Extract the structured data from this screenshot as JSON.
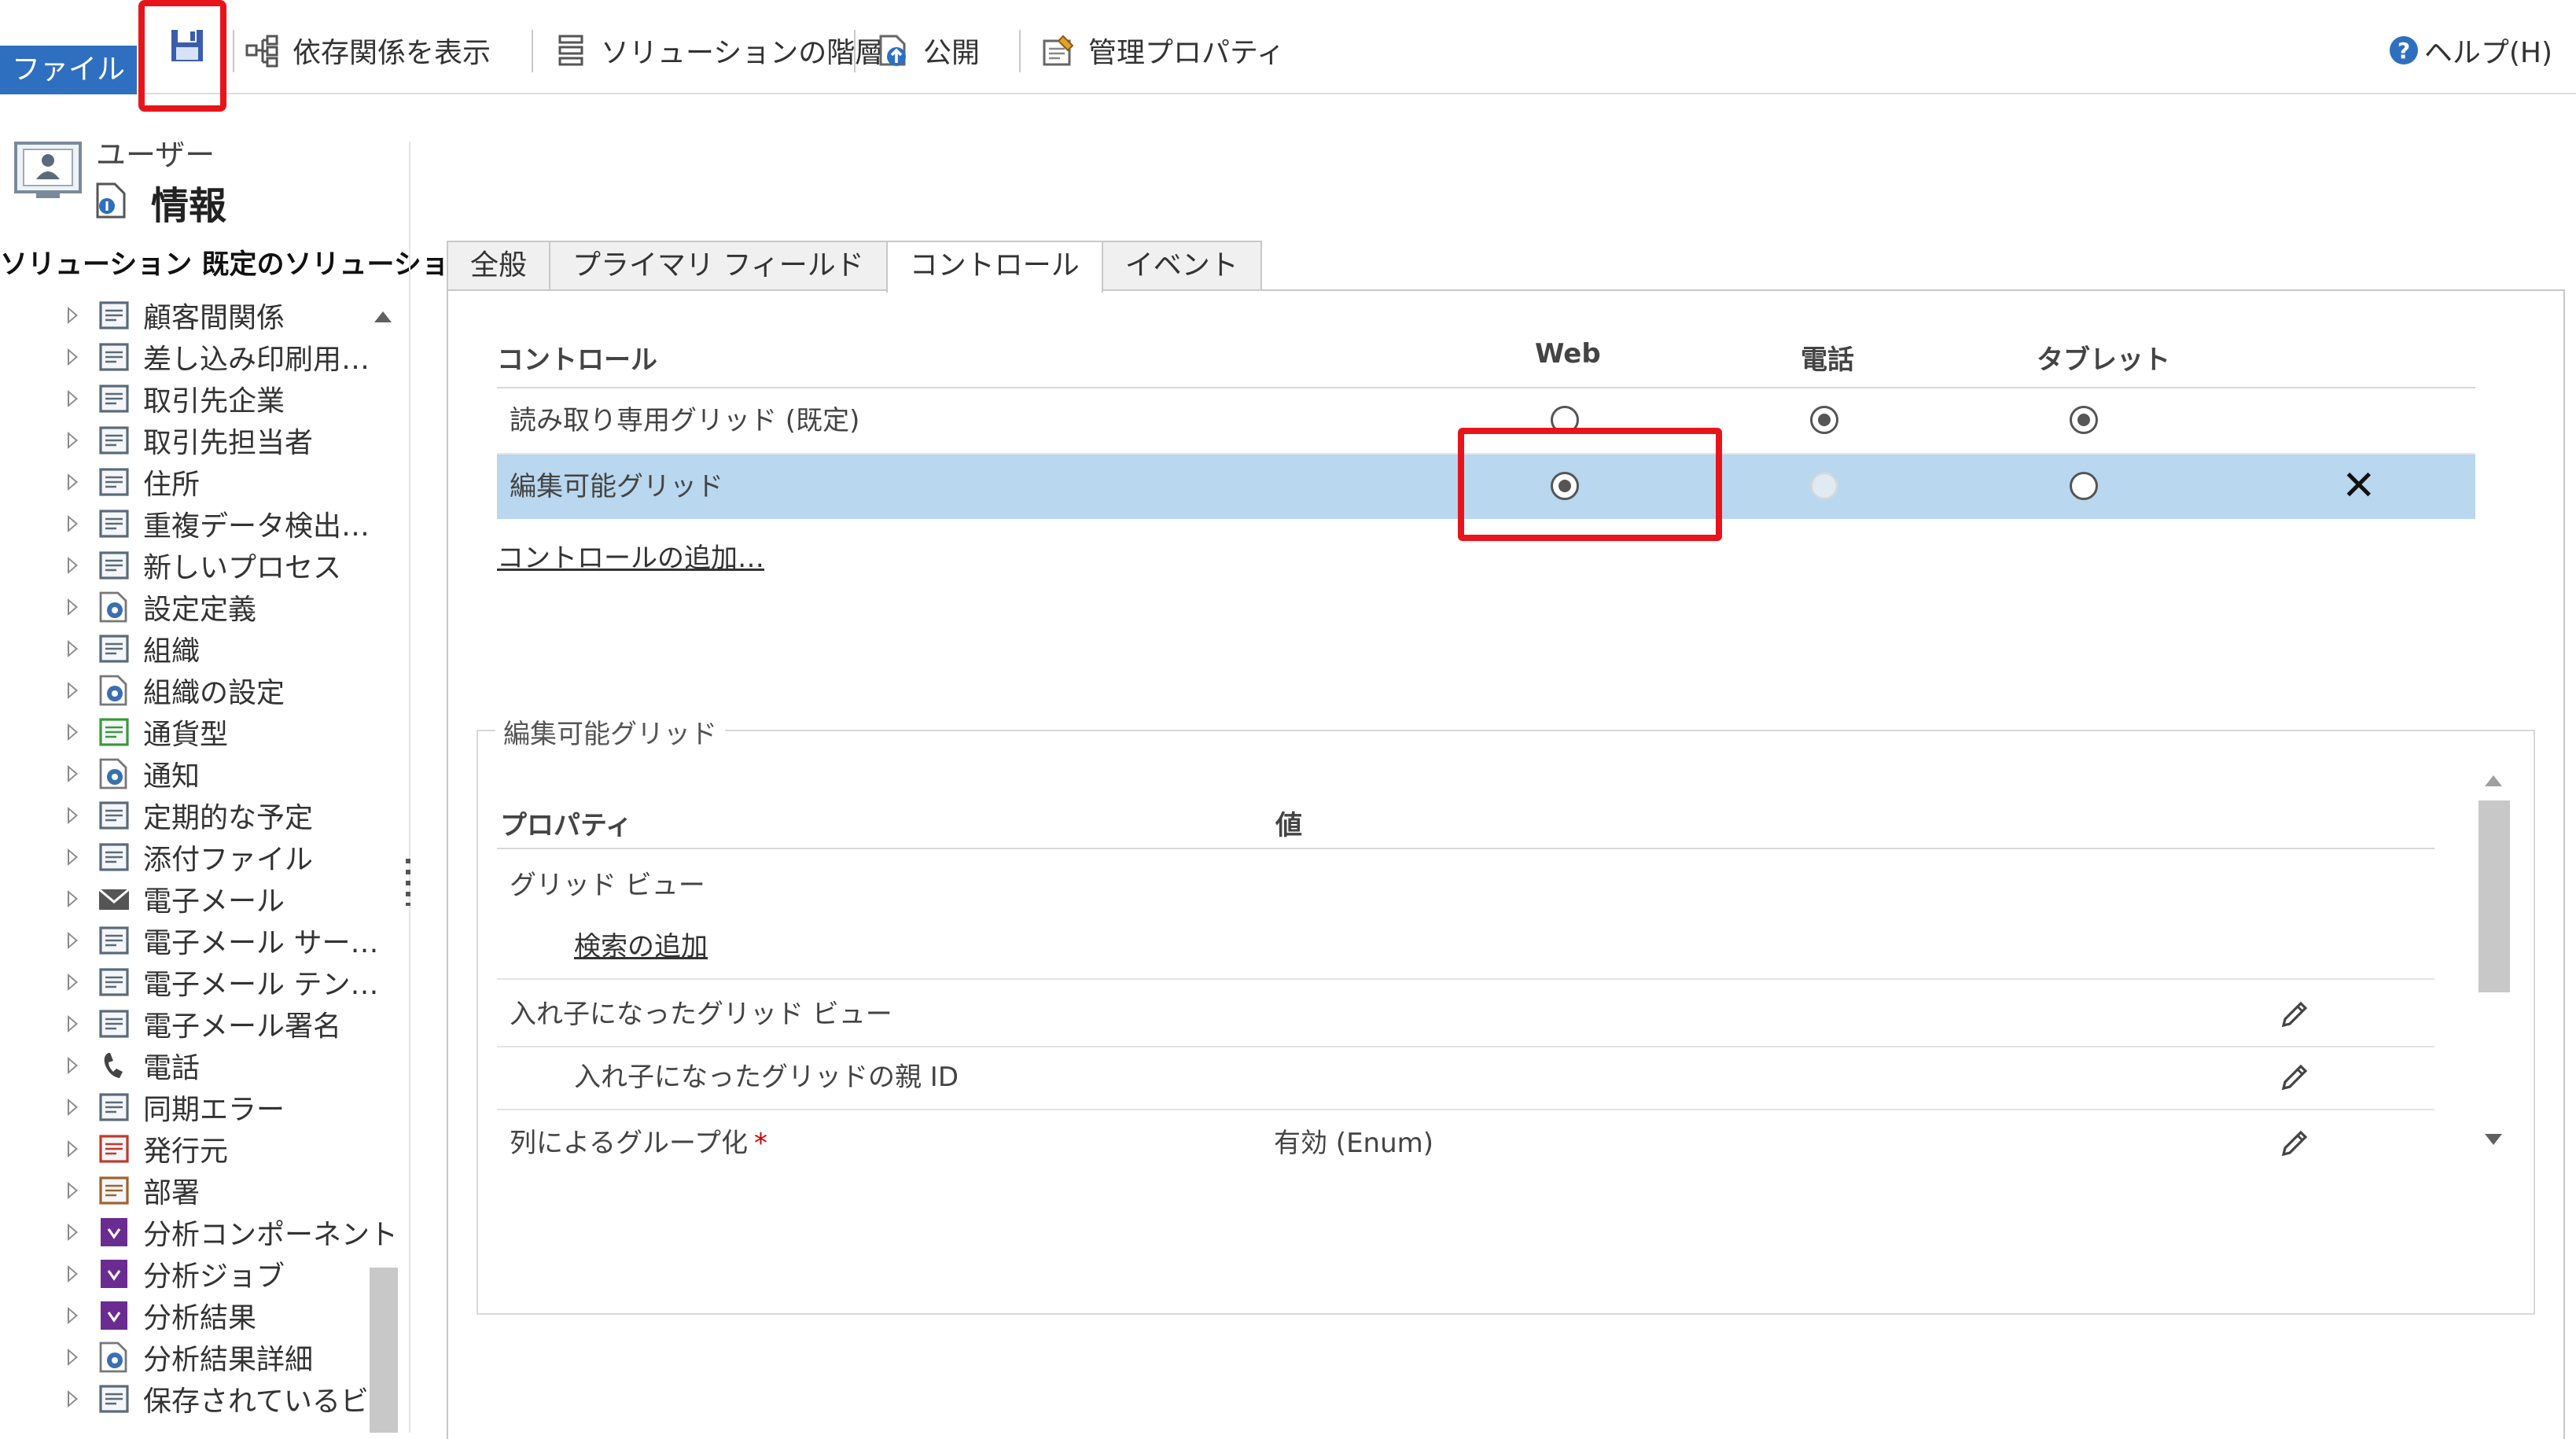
{
  "ribbon": {
    "file_label": "ファイル",
    "save_tooltip": "保存",
    "buttons": [
      {
        "label": "依存関係を表示",
        "icon": "dependencies-icon"
      },
      {
        "label": "ソリューションの階層",
        "icon": "solution-layers-icon"
      },
      {
        "label": "公開",
        "icon": "publish-icon"
      },
      {
        "label": "管理プロパティ",
        "icon": "managed-properties-icon"
      }
    ],
    "help_label": "ヘルプ(H)"
  },
  "sidebar": {
    "entity_type": "ユーザー",
    "page_title": "情報",
    "solution_label": "ソリューション 既定のソリューション",
    "tree_items": [
      {
        "label": "顧客間関係",
        "icon": "people-icon"
      },
      {
        "label": "差し込み印刷用…",
        "icon": "mail-merge-icon"
      },
      {
        "label": "取引先企業",
        "icon": "account-icon"
      },
      {
        "label": "取引先担当者",
        "icon": "contact-icon"
      },
      {
        "label": "住所",
        "icon": "address-icon"
      },
      {
        "label": "重複データ検出…",
        "icon": "duplicate-detection-icon"
      },
      {
        "label": "新しいプロセス",
        "icon": "process-icon"
      },
      {
        "label": "設定定義",
        "icon": "settings-icon"
      },
      {
        "label": "組織",
        "icon": "organization-icon"
      },
      {
        "label": "組織の設定",
        "icon": "settings-icon"
      },
      {
        "label": "通貨型",
        "icon": "currency-icon"
      },
      {
        "label": "通知",
        "icon": "settings-icon"
      },
      {
        "label": "定期的な予定",
        "icon": "recurring-icon"
      },
      {
        "label": "添付ファイル",
        "icon": "attachment-icon"
      },
      {
        "label": "電子メール",
        "icon": "email-icon"
      },
      {
        "label": "電子メール サー…",
        "icon": "email-server-icon"
      },
      {
        "label": "電子メール テン…",
        "icon": "email-template-icon"
      },
      {
        "label": "電子メール署名",
        "icon": "email-signature-icon"
      },
      {
        "label": "電話",
        "icon": "phone-icon"
      },
      {
        "label": "同期エラー",
        "icon": "sync-error-icon"
      },
      {
        "label": "発行元",
        "icon": "publisher-icon"
      },
      {
        "label": "部署",
        "icon": "business-unit-icon"
      },
      {
        "label": "分析コンポーネント",
        "icon": "analysis-icon"
      },
      {
        "label": "分析ジョブ",
        "icon": "analysis-icon"
      },
      {
        "label": "分析結果",
        "icon": "analysis-icon"
      },
      {
        "label": "分析結果詳細",
        "icon": "settings-icon"
      },
      {
        "label": "保存されているビ…",
        "icon": "saved-view-icon"
      }
    ]
  },
  "tabs": [
    "全般",
    "プライマリ フィールド",
    "コントロール",
    "イベント"
  ],
  "controls": {
    "headers": {
      "control": "コントロール",
      "web": "Web",
      "phone": "電話",
      "tablet": "タブレット"
    },
    "rows": [
      {
        "name": "読み取り専用グリッド (既定)",
        "web": false,
        "phone": true,
        "tablet": true
      },
      {
        "name": "編集可能グリッド",
        "web": true,
        "phone": "disabled",
        "tablet": false
      }
    ],
    "add_control_link": "コントロールの追加…"
  },
  "properties": {
    "group_title": "編集可能グリッド",
    "headers": {
      "property": "プロパティ",
      "value": "値"
    },
    "rows": [
      {
        "name": "グリッド ビュー",
        "value": "",
        "editable": false
      },
      {
        "name": "検索の追加",
        "value": "",
        "editable": false,
        "link": true
      },
      {
        "name": "入れ子になったグリッド ビュー",
        "value": "",
        "editable": true
      },
      {
        "name": "入れ子になったグリッドの親 ID",
        "value": "",
        "editable": true
      },
      {
        "name": "列によるグループ化",
        "required": "*",
        "value": "有効 (Enum)",
        "editable": true
      }
    ]
  },
  "colors": {
    "highlight_red": "#e8141b",
    "file_blue": "#2e6fc0",
    "selected_row": "#b9d7ee"
  }
}
